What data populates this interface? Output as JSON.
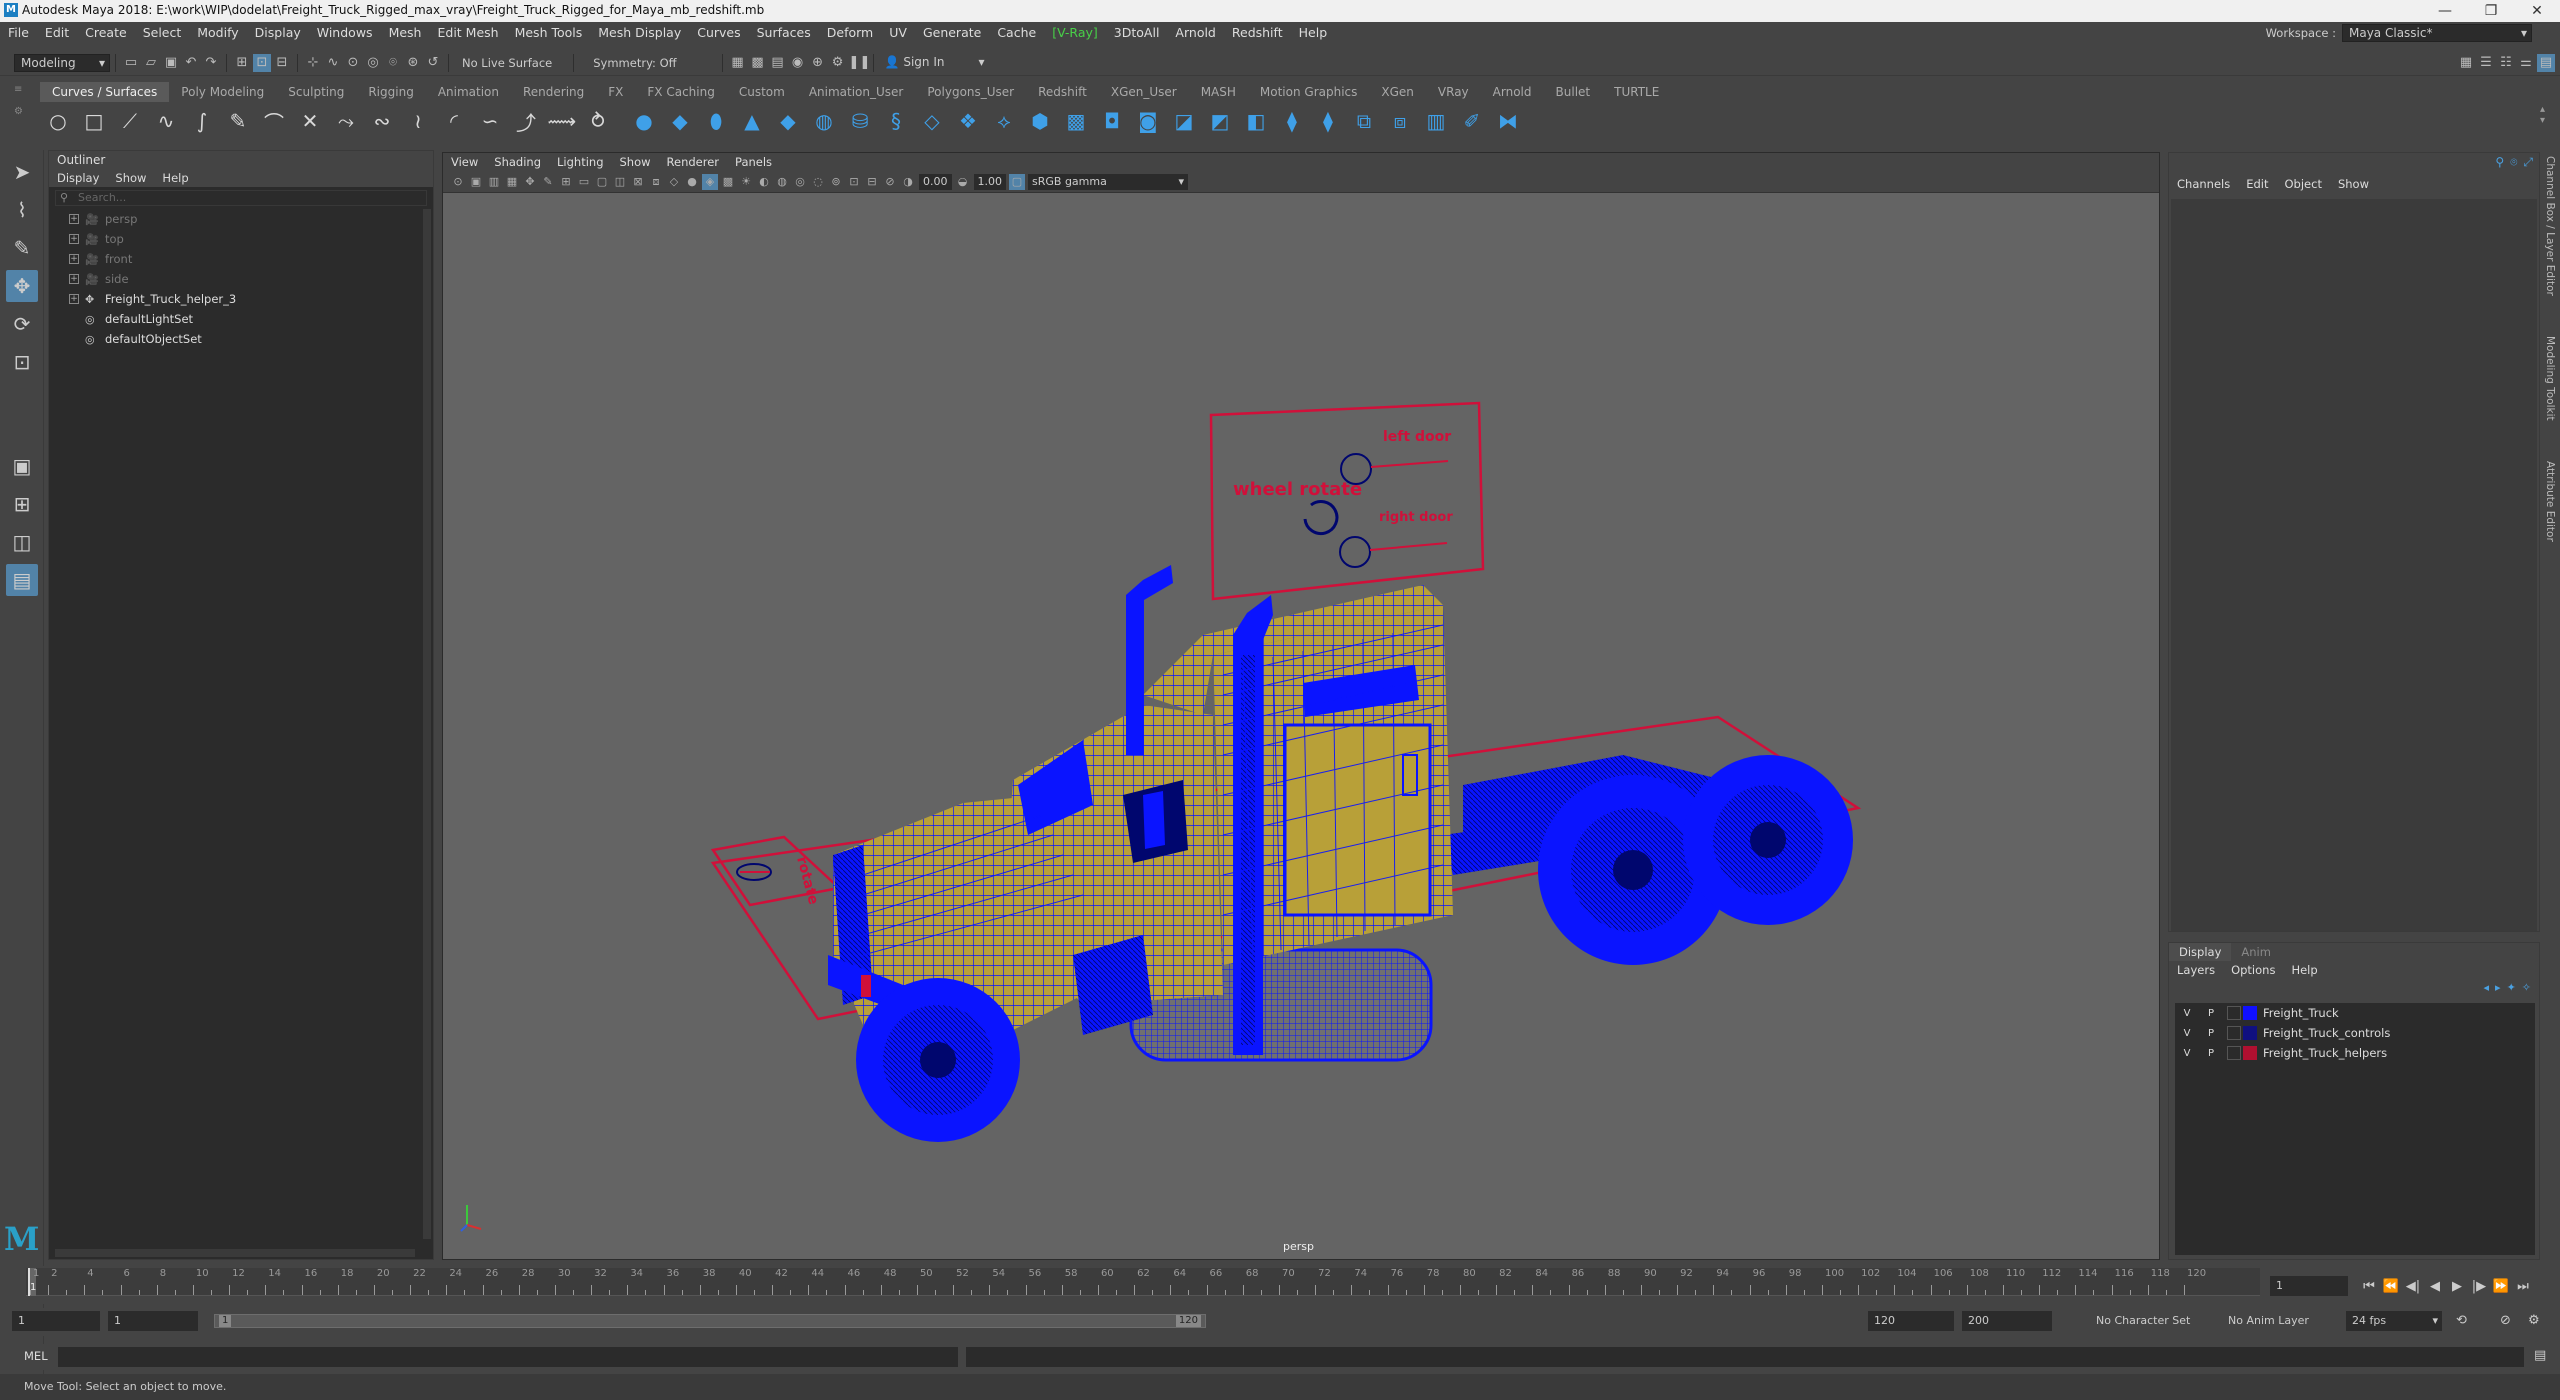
{
  "titlebar": {
    "title": "Autodesk Maya 2018: E:\\work\\WIP\\dodelat\\Freight_Truck_Rigged_max_vray\\Freight_Truck_Rigged_for_Maya_mb_redshift.mb",
    "minimize": "—",
    "restore": "❐",
    "close": "✕"
  },
  "menubar": {
    "items": [
      "File",
      "Edit",
      "Create",
      "Select",
      "Modify",
      "Display",
      "Windows",
      "Mesh",
      "Edit Mesh",
      "Mesh Tools",
      "Mesh Display",
      "Curves",
      "Surfaces",
      "Deform",
      "UV",
      "Generate",
      "Cache"
    ],
    "vray": "V-Ray",
    "items2": [
      "3DtoAll",
      "Arnold",
      "Redshift",
      "Help"
    ],
    "workspace_label": "Workspace :",
    "workspace_value": "Maya Classic*"
  },
  "statusline": {
    "mode": "Modeling",
    "live_surface": "No Live Surface",
    "symmetry": "Symmetry: Off",
    "sign_in": "Sign In"
  },
  "shelf": {
    "tabs": [
      "Curves / Surfaces",
      "Poly Modeling",
      "Sculpting",
      "Rigging",
      "Animation",
      "Rendering",
      "FX",
      "FX Caching",
      "Custom",
      "Animation_User",
      "Polygons_User",
      "Redshift",
      "XGen_User",
      "MASH",
      "Motion Graphics",
      "XGen",
      "VRay",
      "Arnold",
      "Bullet",
      "TURTLE"
    ],
    "active_tab": "Curves / Surfaces"
  },
  "outliner": {
    "title": "Outliner",
    "menu": [
      "Display",
      "Show",
      "Help"
    ],
    "search_placeholder": "Search...",
    "items": [
      {
        "label": "persp",
        "dim": true,
        "icon": "camera-icon"
      },
      {
        "label": "top",
        "dim": true,
        "icon": "camera-icon"
      },
      {
        "label": "front",
        "dim": true,
        "icon": "camera-icon"
      },
      {
        "label": "side",
        "dim": true,
        "icon": "camera-icon"
      },
      {
        "label": "Freight_Truck_helper_3",
        "dim": false,
        "icon": "transform-icon"
      },
      {
        "label": "defaultLightSet",
        "dim": false,
        "icon": "set-icon"
      },
      {
        "label": "defaultObjectSet",
        "dim": false,
        "icon": "set-icon"
      }
    ]
  },
  "viewport": {
    "menu": [
      "View",
      "Shading",
      "Lighting",
      "Show",
      "Renderer",
      "Panels"
    ],
    "exposure": "0.00",
    "gamma": "1.00",
    "color_space": "sRGB gamma",
    "camera_label": "persp",
    "helper_labels": {
      "left_door": "left door",
      "wheel_rotate": "wheel rotate",
      "right_door": "right door",
      "rotate_ctrl": "rotate"
    },
    "colors": {
      "wire": "#0a14ff",
      "body": "#b8a038",
      "helper": "#d0103a"
    }
  },
  "channelbox": {
    "menu": [
      "Channels",
      "Edit",
      "Object",
      "Show"
    ]
  },
  "layereditor": {
    "tabs": [
      "Display",
      "Anim"
    ],
    "active_tab": "Display",
    "menu": [
      "Layers",
      "Options",
      "Help"
    ],
    "layers": [
      {
        "v": "V",
        "p": "P",
        "name": "Freight_Truck",
        "color": "#1010ff"
      },
      {
        "v": "V",
        "p": "P",
        "name": "Freight_Truck_controls",
        "color": "#101080"
      },
      {
        "v": "V",
        "p": "P",
        "name": "Freight_Truck_helpers",
        "color": "#b01030"
      }
    ]
  },
  "rightstrip": {
    "tabs": [
      "Channel Box / Layer Editor",
      "Modeling Toolkit",
      "Attribute Editor"
    ]
  },
  "timeslider": {
    "current_frame": "1",
    "labels": [
      "1",
      "2",
      "4",
      "6",
      "8",
      "10",
      "12",
      "14",
      "16",
      "18",
      "20",
      "22",
      "24",
      "26",
      "28",
      "30",
      "32",
      "34",
      "36",
      "38",
      "40",
      "42",
      "44",
      "46",
      "48",
      "50",
      "52",
      "54",
      "56",
      "58",
      "60",
      "62",
      "64",
      "66",
      "68",
      "70",
      "72",
      "74",
      "76",
      "78",
      "80",
      "82",
      "84",
      "86",
      "88",
      "90",
      "92",
      "94",
      "96",
      "98",
      "100",
      "102",
      "104",
      "106",
      "108",
      "110",
      "112",
      "114",
      "116",
      "118",
      "120"
    ],
    "frame_field": "1"
  },
  "rangeslider": {
    "start": "1",
    "anim_start": "1",
    "range_start": "1",
    "range_end": "120",
    "anim_end": "120",
    "end": "200",
    "character_set": "No Character Set",
    "anim_layer": "No Anim Layer",
    "fps": "24 fps"
  },
  "cmdline": {
    "label": "MEL"
  },
  "helpline": {
    "text": "Move Tool: Select an object to move."
  }
}
